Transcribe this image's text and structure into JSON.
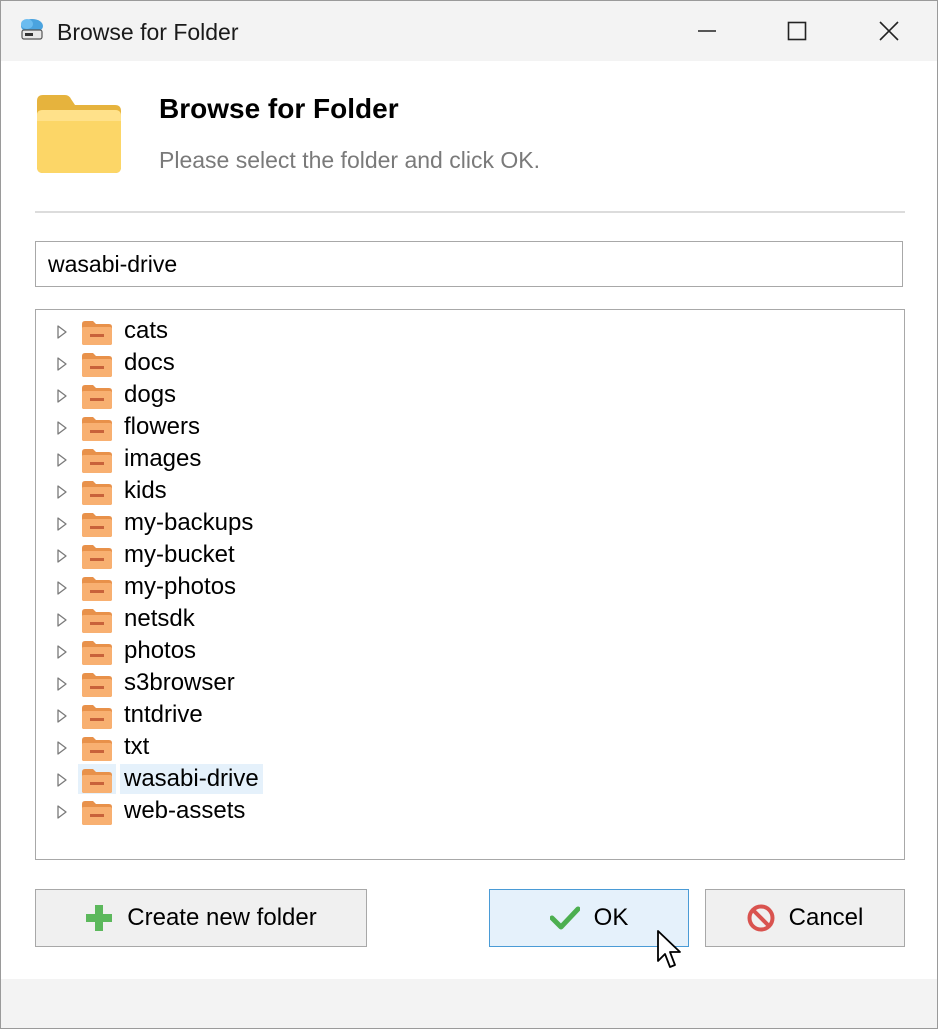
{
  "window": {
    "title": "Browse for Folder"
  },
  "header": {
    "title": "Browse for Folder",
    "subtitle": "Please select the folder and click OK."
  },
  "path_field": {
    "value": "wasabi-drive"
  },
  "tree": {
    "selected": "wasabi-drive",
    "items": [
      {
        "label": "cats"
      },
      {
        "label": "docs"
      },
      {
        "label": "dogs"
      },
      {
        "label": "flowers"
      },
      {
        "label": "images"
      },
      {
        "label": "kids"
      },
      {
        "label": "my-backups"
      },
      {
        "label": "my-bucket"
      },
      {
        "label": "my-photos"
      },
      {
        "label": "netsdk"
      },
      {
        "label": "photos"
      },
      {
        "label": "s3browser"
      },
      {
        "label": "tntdrive"
      },
      {
        "label": "txt"
      },
      {
        "label": "wasabi-drive"
      },
      {
        "label": "web-assets"
      }
    ]
  },
  "buttons": {
    "create_label": "Create new folder",
    "ok_label": "OK",
    "cancel_label": "Cancel"
  },
  "icons": {
    "app": "cloud-drive-icon",
    "header": "folder-icon",
    "create": "plus-icon",
    "ok": "checkmark-icon",
    "cancel": "no-entry-icon"
  },
  "colors": {
    "accent": "#4a9bd6",
    "selection": "#e5f1fb",
    "folder": "#f6a55a",
    "plus": "#5cb85c",
    "check": "#4caf50",
    "cancel": "#d9534f"
  }
}
